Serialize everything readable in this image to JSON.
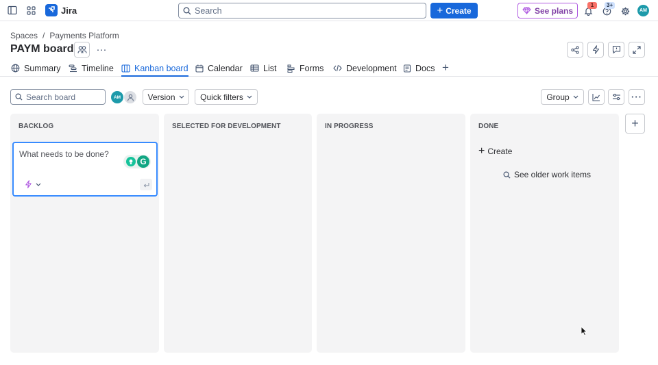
{
  "topbar": {
    "app_name": "Jira",
    "search_placeholder": "Search",
    "create_label": "Create",
    "see_plans_label": "See plans",
    "notifications_badge": "1",
    "help_badge": "3+",
    "user_initials": "AM"
  },
  "header": {
    "breadcrumb": [
      "Spaces",
      "Payments Platform"
    ],
    "title": "PAYM board",
    "more_label": "···"
  },
  "tabs": [
    {
      "label": "Summary",
      "icon": "globe-icon"
    },
    {
      "label": "Timeline",
      "icon": "timeline-icon"
    },
    {
      "label": "Kanban board",
      "icon": "board-icon",
      "active": true
    },
    {
      "label": "Calendar",
      "icon": "calendar-icon"
    },
    {
      "label": "List",
      "icon": "list-icon"
    },
    {
      "label": "Forms",
      "icon": "forms-icon"
    },
    {
      "label": "Development",
      "icon": "code-icon"
    },
    {
      "label": "Docs",
      "icon": "docs-icon"
    }
  ],
  "toolbar": {
    "search_placeholder": "Search board",
    "avatar_initials": "AM",
    "version_label": "Version",
    "quick_filters_label": "Quick filters",
    "group_label": "Group"
  },
  "columns": [
    {
      "title": "BACKLOG"
    },
    {
      "title": "SELECTED FOR DEVELOPMENT"
    },
    {
      "title": "IN PROGRESS"
    },
    {
      "title": "DONE"
    }
  ],
  "backlog": {
    "new_card_placeholder": "What needs to be done?",
    "grammarly_letter": "G"
  },
  "done": {
    "create_label": "Create",
    "older_items_label": "See older work items"
  },
  "colors": {
    "accent": "#1868db",
    "column_bg": "#f4f4f5",
    "see_plans": "#af59e1",
    "avatar": "#1d9aaa",
    "grammarly": "#11a683"
  }
}
